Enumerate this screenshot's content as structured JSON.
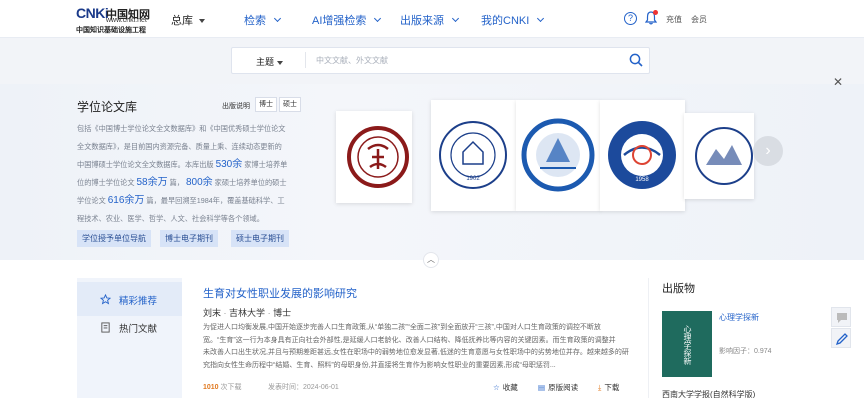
{
  "header": {
    "logo_mark": "CNKi",
    "logo_cn": "中国知网",
    "logo_url": "www.cnki.net",
    "logo_sub": "中国知识基础设施工程",
    "home": "总库",
    "nav": [
      {
        "label": "检索"
      },
      {
        "label": "AI增强检索"
      },
      {
        "label": "出版来源"
      },
      {
        "label": "我的CNKI"
      }
    ],
    "recharge": "充值",
    "member": "会员"
  },
  "search": {
    "field_type": "主题",
    "placeholder": "中文文献、外文文献"
  },
  "banner": {
    "title": "学位论文库",
    "tag_label": "出版说明",
    "tags": [
      "博士",
      "硕士"
    ],
    "desc": [
      "包括《中国博士学位论文全文数据库》和《中国优秀硕士学位论文",
      "全文数据库》，是目前国内资源完备、质量上乘、连续动态更新的",
      "中国博硕士学位论文全文数据库。本库出版 ",
      "530余",
      " 家博士培养单",
      "位的博士学位论文 ",
      "58余万",
      " 篇， ",
      "800余",
      " 家硕士培养单位的硕士",
      "学位论文 ",
      "616余万",
      " 篇，最早回溯至1984年，覆盖基础科学、工",
      "程技术、农业、医学、哲学、人文、社会科学等各个领域。"
    ],
    "buttons": [
      "学位授予单位导航",
      "博士电子期刊",
      "硕士电子期刊"
    ],
    "universities": [
      {
        "name": "Peking University",
        "color": "#8b1a1a"
      },
      {
        "name": "Beijing Normal University",
        "color": "#1c3f8a"
      },
      {
        "name": "Dalian University of Technology",
        "color": "#1c5ab0"
      },
      {
        "name": "USTC",
        "color": "#1c4a9c"
      },
      {
        "name": "University 5",
        "color": "#1c3f8a"
      }
    ]
  },
  "sidebar": {
    "tabs": [
      {
        "label": "精彩推荐",
        "active": true
      },
      {
        "label": "热门文献",
        "active": false
      }
    ]
  },
  "article": {
    "title": "生育对女性职业发展的影响研究",
    "author": "刘末",
    "university": "吉林大学",
    "degree": "博士",
    "abstract": [
      "为促进人口均衡发展,中国开始逐步完善人口生育政策,从“单独二孩”“全面二孩”到全面放开“三孩”,中国对人口生育政策的调控不断放",
      "宽。“生育”这一行为本身具有正向社会外部性,是延缓人口老龄化、改善人口结构、降低抚养比等内容的关键因素。而生育政策的调整并",
      "未改善人口出生状况,并且与预期差距甚远,女性在职场中的弱势地位愈发显著,低迷的生育意愿与女性职场中的劣势地位并存。越来越多的研",
      "究指向女性生命历程中“结婚、生育、照料”的母职身份,并直接将生育作为影响女性职业的重要因素,形成“母职惩罚..."
    ],
    "downloads": "1010",
    "downloads_label": "次下载",
    "date_label": "发表时间：",
    "date": "2024-06-01",
    "actions": [
      "收藏",
      "原版阅读",
      "下载"
    ]
  },
  "publications": {
    "title": "出版物",
    "items": [
      {
        "name": "心理学探新",
        "impact_label": "影响因子：",
        "impact": "0.974",
        "cover_text": "心理学探新"
      }
    ],
    "next_name": "西南大学学报(自然科学版)"
  }
}
